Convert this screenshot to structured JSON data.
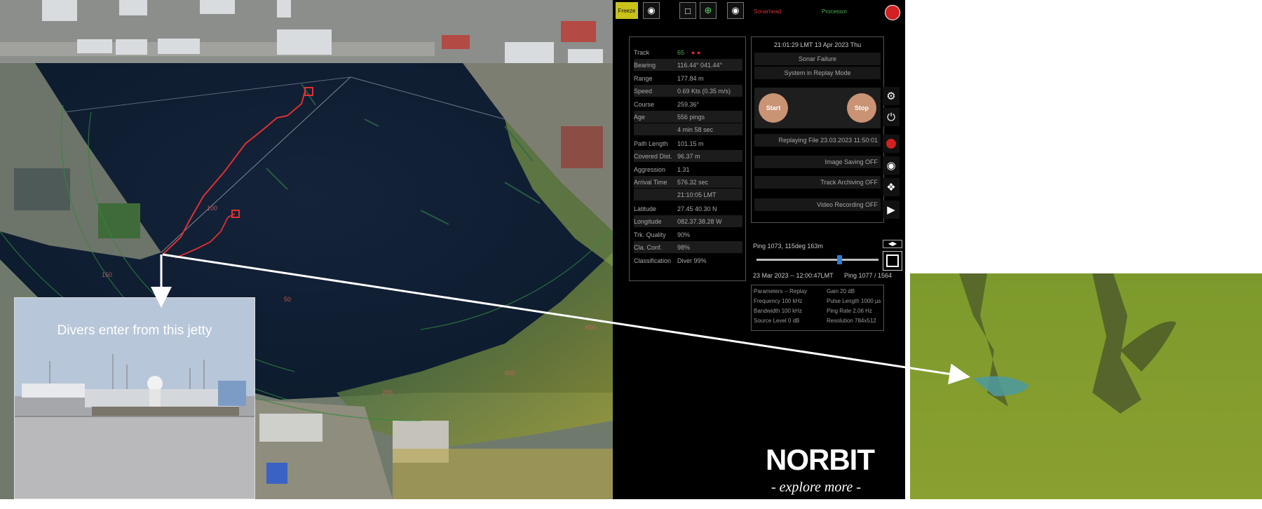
{
  "map": {
    "rings": [
      "150",
      "100",
      "150",
      "50",
      "200",
      "600",
      "650"
    ]
  },
  "toolbar": {
    "freeze_label": "Freeze",
    "camera_icon": "camera-icon",
    "square_icon": "square-icon",
    "target_icon": "crosshair-icon",
    "map_icon": "map-pin-icon",
    "status_left": "Sonarhead",
    "status_right": "Processor",
    "colors": {
      "status_left": "#d22f2f",
      "status_right": "#4caf50",
      "record": "#d32020"
    }
  },
  "track": {
    "rows": [
      {
        "label": "Track",
        "value": "65"
      },
      {
        "label": "Bearing",
        "value": "116.44°   041.44°"
      },
      {
        "label": "Range",
        "value": "177.84 m"
      },
      {
        "label": "Speed",
        "value": "0.69 Kts (0.35 m/s)"
      },
      {
        "label": "Course",
        "value": "259.36°"
      },
      {
        "label": "Age",
        "value": "556 pings"
      },
      {
        "label": "",
        "value": "4 min 58 sec"
      },
      {
        "label": "Path Length",
        "value": "101.15 m"
      },
      {
        "label": "Covered Dist.",
        "value": "96.37 m"
      },
      {
        "label": "Aggression",
        "value": "1.31"
      },
      {
        "label": "Arrival Time",
        "value": "576.32 sec"
      },
      {
        "label": "",
        "value": "21:10:05 LMT"
      },
      {
        "label": "Latitude",
        "value": "27.45 40.30 N"
      },
      {
        "label": "Longitude",
        "value": "082.37.38.28 W"
      },
      {
        "label": "Trk. Quality",
        "value": "90%"
      },
      {
        "label": "Cla. Conf.",
        "value": "98%"
      },
      {
        "label": "Classification",
        "value": "Diver 99%"
      }
    ]
  },
  "status": {
    "datetime": "21:01:29 LMT  13 Apr 2023  Thu",
    "sonar_failure": "Sonar Failure",
    "replay_mode": "System in Replay Mode",
    "start_label": "Start",
    "stop_label": "Stop",
    "replaying_file": "Replaying File 23.03.2023  11:50:01",
    "image_saving": "Image Saving OFF",
    "track_archiving": "Track Archiving OFF",
    "video_recording": "Video Recording OFF",
    "icons": [
      "gear-icon",
      "power-icon",
      "record-icon",
      "camera-icon",
      "track-archive-icon",
      "video-camera-icon"
    ]
  },
  "playback": {
    "ping_info": "Ping 1073, 115deg 163m",
    "timestamp": "23 Mar 2023 -- 12:00:47LMT",
    "ping_count": "Ping 1077 / 1564",
    "slider_fraction": 0.68
  },
  "params": {
    "left": [
      "Parameters -- Replay",
      "Frequency  100 kHz",
      "Bandwidth  100 kHz",
      "Source Level  0 dB"
    ],
    "right": [
      "Gain  20 dB",
      "Pulse Length  1000 µs",
      "Ping Rate     2.06 Hz",
      "Resolution  784x512"
    ]
  },
  "brand": {
    "logo": "NORBIT",
    "tagline": "- explore more -"
  },
  "jetty": {
    "caption": "Divers enter from this jetty"
  }
}
